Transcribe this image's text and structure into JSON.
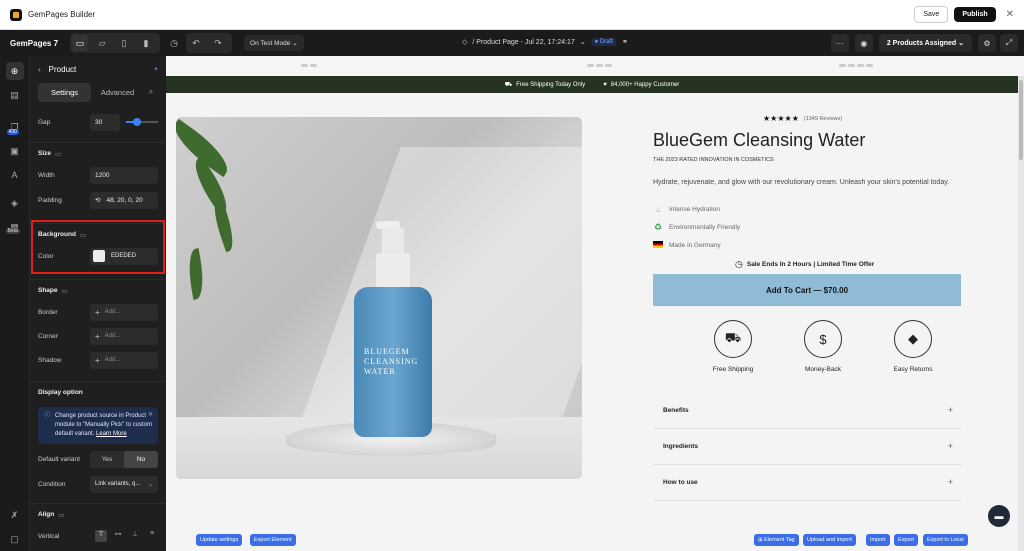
{
  "window": {
    "title": "GemPages Builder",
    "save": "Save",
    "publish": "Publish",
    "close": "✕"
  },
  "toolbar": {
    "brand": "GemPages 7",
    "mode": "On Test Mode",
    "page_title": "/ Product Page - Jul 22, 17:24:17",
    "draft": "Draft",
    "assigned": "2 Products Assigned",
    "more": "···"
  },
  "rail": {
    "badge": "430",
    "beta": "Beta"
  },
  "panel": {
    "title": "Product",
    "tabs": [
      "Settings",
      "Advanced"
    ],
    "gap": {
      "label": "Gap",
      "value": "30",
      "slider_fraction": 0.35
    },
    "size": {
      "title": "Size",
      "width_label": "Width",
      "width_value": "1200",
      "padding_label": "Padding",
      "padding_value": "48, 20, 0, 20"
    },
    "background": {
      "title": "Background",
      "color_label": "Color",
      "color_value": "EDEDED",
      "swatch": "#ededed"
    },
    "shape": {
      "title": "Shape",
      "border_label": "Border",
      "corner_label": "Corner",
      "shadow_label": "Shadow",
      "add_placeholder": "Add..."
    },
    "display": {
      "title": "Display option",
      "notice": "Change product source in Product module to \"Manually Pick\" to custom default variant.",
      "learn_more": "Learn More",
      "default_variant_label": "Default variant",
      "yes": "Yes",
      "no": "No",
      "condition_label": "Condition",
      "condition_value": "Link variants, q..."
    },
    "align": {
      "title": "Align",
      "vertical_label": "Vertical"
    }
  },
  "announce": {
    "shipping": "Free Shipping Today Only",
    "customers": "84,000+ Happy Customer"
  },
  "product": {
    "stars": "★★★★★",
    "reviews": "(1349 Reviews)",
    "title": "BlueGem Cleansing Water",
    "subtitle": "THE 2023 RATED INNOVATION IN COSMETICS",
    "description": "Hydrate, rejuvenate, and glow with our revolutionary cream. Unleash your skin's potential today.",
    "features": [
      "Intense Hydration",
      "Environmentally Friendly",
      "Made in Germany"
    ],
    "sale": "Sale Ends In 2 Hours | Limited Time Offer",
    "cart": "Add To Cart  —  $70.00",
    "perks": [
      "Free Shipping",
      "Money-Back",
      "Easy Returns"
    ],
    "accordions": [
      "Benefits",
      "Ingredients",
      "How to use"
    ],
    "bottle_label": [
      "BLUEGEM",
      "CLEANSING",
      "WATER"
    ]
  },
  "bottom_chips": {
    "left": [
      "Update settings",
      "Export Element"
    ],
    "right": [
      "⊞ Element Tag",
      "Upload and import",
      "Import",
      "Export",
      "Export to Local"
    ]
  },
  "colors": {
    "announce_bg": "#273322",
    "cart_bg": "#8fbbd6",
    "accent": "#3b82f6",
    "highlight": "#e11d1d"
  }
}
